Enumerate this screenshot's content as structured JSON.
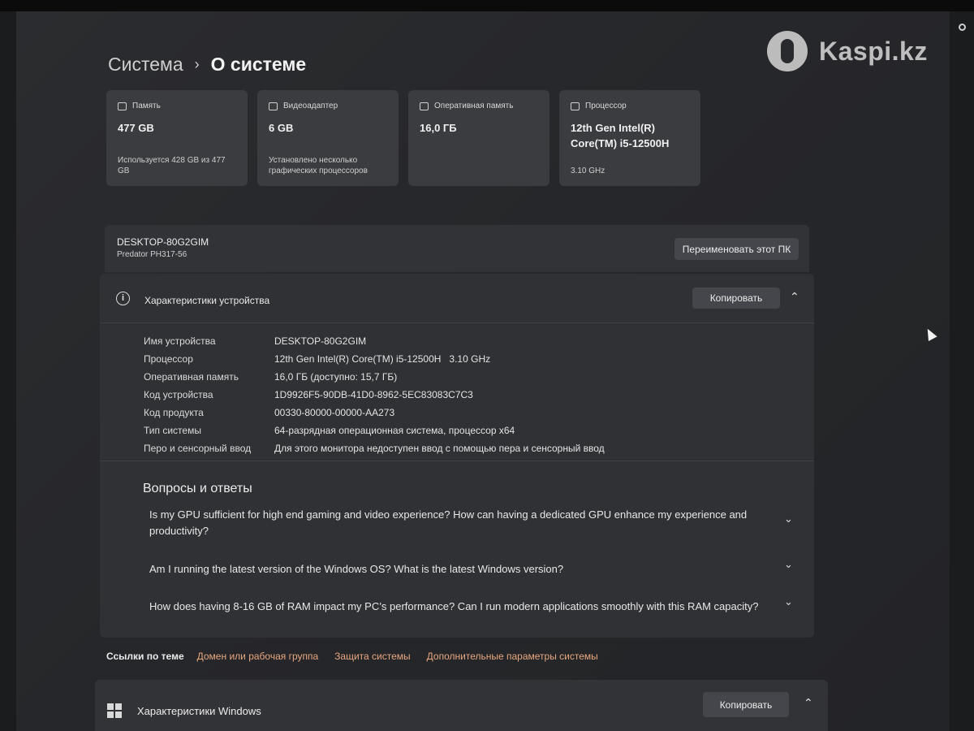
{
  "watermark": {
    "text": "Kaspi.kz"
  },
  "breadcrumb": {
    "parent": "Система",
    "separator": "›",
    "current": "О системе"
  },
  "tiles": [
    {
      "icon": "storage-icon",
      "label": "Память",
      "value": "477 GB",
      "sub": "Используется 428 GB из 477 GB"
    },
    {
      "icon": "gpu-icon",
      "label": "Видеоадаптер",
      "value": "6 GB",
      "sub": "Установлено несколько графических процессоров"
    },
    {
      "icon": "ram-icon",
      "label": "Оперативная память",
      "value": "16,0 ГБ",
      "sub": ""
    },
    {
      "icon": "cpu-icon",
      "label": "Процессор",
      "value": "12th Gen Intel(R) Core(TM) i5-12500H",
      "sub": "3.10 GHz"
    }
  ],
  "pc": {
    "name": "DESKTOP-80G2GIM",
    "model": "Predator PH317-56",
    "rename_label": "Переименовать этот ПК"
  },
  "device_specs": {
    "title": "Характеристики устройства",
    "copy_label": "Копировать",
    "rows": [
      {
        "label": "Имя устройства",
        "value": "DESKTOP-80G2GIM"
      },
      {
        "label": "Процессор",
        "value": "12th Gen Intel(R) Core(TM) i5-12500H   3.10 GHz"
      },
      {
        "label": "Оперативная память",
        "value": "16,0 ГБ (доступно: 15,7 ГБ)"
      },
      {
        "label": "Код устройства",
        "value": "1D9926F5-90DB-41D0-8962-5EC83083C7C3"
      },
      {
        "label": "Код продукта",
        "value": "00330-80000-00000-AA273"
      },
      {
        "label": "Тип системы",
        "value": "64-разрядная операционная система, процессор x64"
      },
      {
        "label": "Перо и сенсорный ввод",
        "value": "Для этого монитора недоступен ввод с помощью пера и сенсорный ввод"
      }
    ]
  },
  "faq": {
    "title": "Вопросы и ответы",
    "items": [
      "Is my GPU sufficient for high end gaming and video experience? How can having a dedicated GPU enhance my experience and productivity?",
      "Am I running the latest version of the Windows OS? What is the latest Windows version?",
      "How does having 8-16 GB of RAM impact my PC’s performance? Can I run modern applications smoothly with this RAM capacity?"
    ]
  },
  "related": {
    "title": "Ссылки по теме",
    "links": [
      "Домен или рабочая группа",
      "Защита системы",
      "Дополнительные параметры системы"
    ]
  },
  "windows_specs": {
    "title": "Характеристики Windows",
    "copy_label": "Копировать"
  },
  "colors": {
    "link": "#e8a77f",
    "card": "#3b3c40",
    "panel": "#303134",
    "background": "#26272a"
  }
}
